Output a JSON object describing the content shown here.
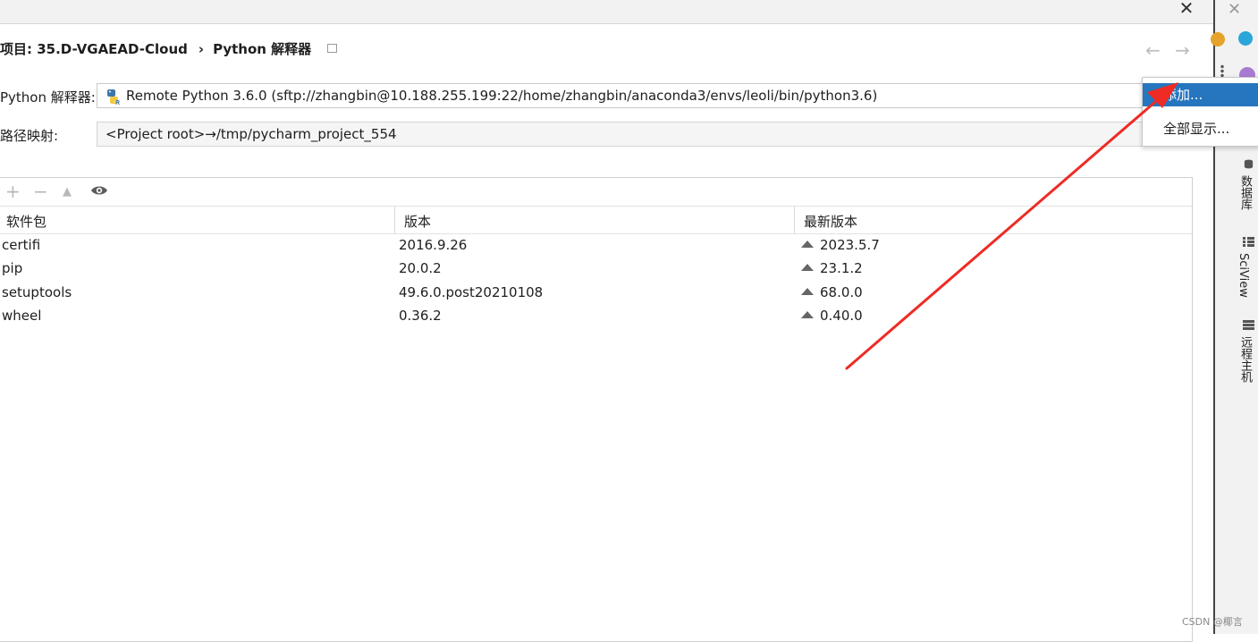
{
  "breadcrumb": {
    "project": "项目: 35.D-VGAEAD-Cloud",
    "separator": "›",
    "current": "Python 解释器"
  },
  "interpreter": {
    "label": "Python 解释器:",
    "value": "Remote Python 3.6.0 (sftp://zhangbin@10.188.255.199:22/home/zhangbin/anaconda3/envs/leoli/bin/python3.6)"
  },
  "path_mapping": {
    "label": "路径映射:",
    "value": "<Project root>→/tmp/pycharm_project_554"
  },
  "toolbar": {
    "add": "+",
    "remove": "−",
    "upgrade": "▲"
  },
  "table": {
    "headers": [
      "软件包",
      "版本",
      "最新版本"
    ],
    "rows": [
      {
        "package": "certifi",
        "version": "2016.9.26",
        "latest": "2023.5.7"
      },
      {
        "package": "pip",
        "version": "20.0.2",
        "latest": "23.1.2"
      },
      {
        "package": "setuptools",
        "version": "49.6.0.post20210108",
        "latest": "68.0.0"
      },
      {
        "package": "wheel",
        "version": "0.36.2",
        "latest": "0.40.0"
      }
    ]
  },
  "popup_menu": {
    "items": [
      "添加...",
      "全部显示..."
    ]
  },
  "right_sidebar": {
    "tabs": [
      "数据库",
      "SciView",
      "远程主机"
    ]
  },
  "window": {
    "close_label": "✕",
    "back_label": "←",
    "forward_label": "→"
  },
  "watermark": "CSDN @椰言",
  "colors": {
    "selection": "#2675bf",
    "annotation_arrow": "#ee2b24"
  }
}
